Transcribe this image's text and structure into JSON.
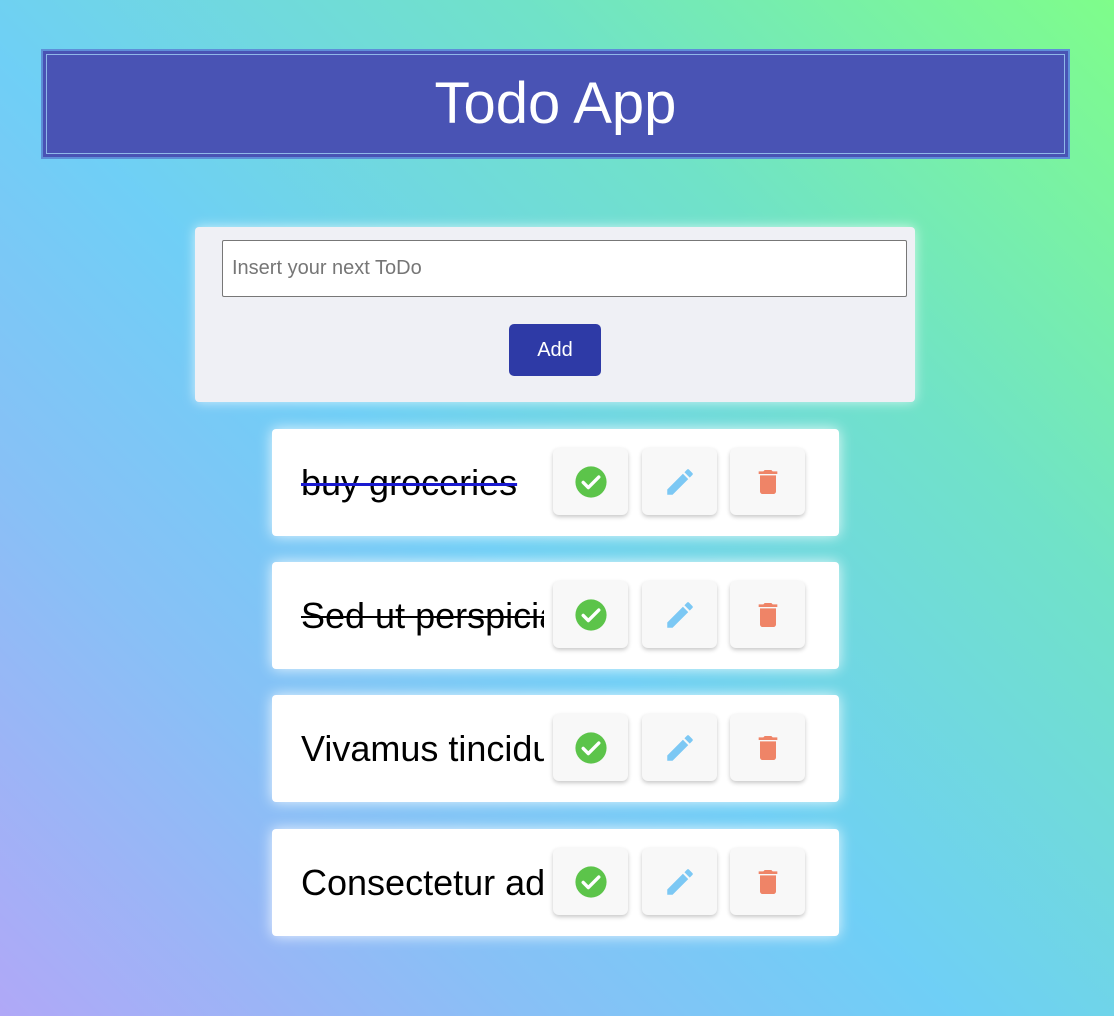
{
  "header": {
    "title": "Todo App"
  },
  "form": {
    "input_placeholder": "Insert your next ToDo",
    "input_value": "",
    "add_label": "Add"
  },
  "todos": [
    {
      "text": "buy groceries",
      "completed": true
    },
    {
      "text": "Sed ut perspiciatis",
      "completed": true
    },
    {
      "text": "Vivamus tincidunt",
      "completed": false
    },
    {
      "text": "Consectetur adipiscing",
      "completed": false
    }
  ],
  "icons": {
    "complete": "check-circle-icon",
    "edit": "pencil-icon",
    "delete": "trash-icon"
  },
  "colors": {
    "header_bg": "#4953b4",
    "add_button_bg": "#2e3aa6",
    "complete_icon": "#5cc44a",
    "edit_icon": "#7cc8f4",
    "delete_icon": "#ef8467"
  }
}
